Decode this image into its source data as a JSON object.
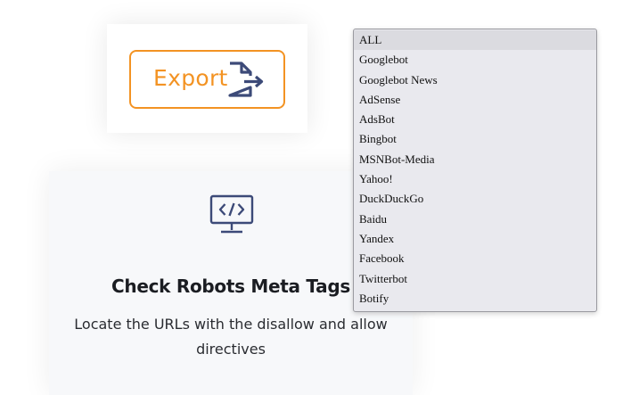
{
  "export_card": {
    "button_label": "Export"
  },
  "feature_card": {
    "icon": "code-monitor-icon",
    "title": "Check Robots Meta Tags",
    "description": "Locate the URLs with the disallow and allow directives"
  },
  "dropdown": {
    "selected": "ALL",
    "options": [
      "ALL",
      "Googlebot",
      "Googlebot News",
      "AdSense",
      "AdsBot",
      "Bingbot",
      "MSNBot-Media",
      "Yahoo!",
      "DuckDuckGo",
      "Baidu",
      "Yandex",
      "Facebook",
      "Twitterbot",
      "Botify"
    ]
  },
  "colors": {
    "accent_orange": "#F39323",
    "icon_navy": "#3C4A78",
    "card_background": "#F7F8FA",
    "dropdown_background": "#E9E9EE"
  }
}
